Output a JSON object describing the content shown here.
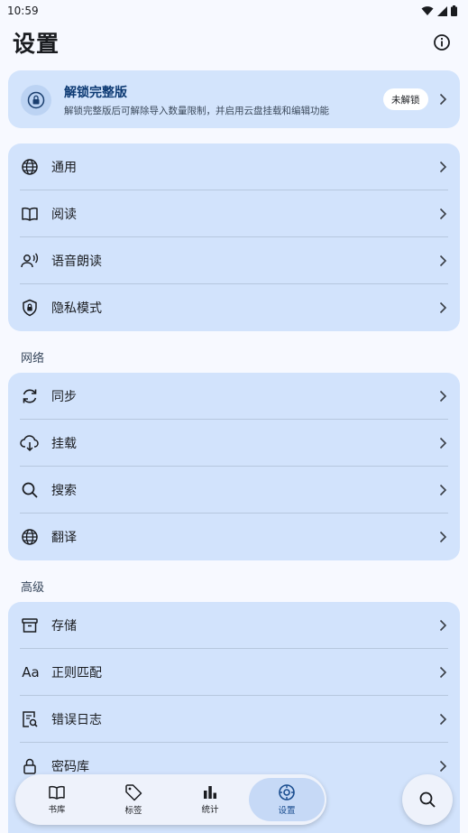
{
  "status_bar": {
    "time": "10:59"
  },
  "app_bar": {
    "title": "设置"
  },
  "unlock": {
    "title": "解锁完整版",
    "description": "解锁完整版后可解除导入数量限制，并启用云盘挂载和编辑功能",
    "badge": "未解锁"
  },
  "general_group": {
    "items": [
      {
        "label": "通用",
        "icon": "globe-icon"
      },
      {
        "label": "阅读",
        "icon": "book-open-icon"
      },
      {
        "label": "语音朗读",
        "icon": "voice-icon"
      },
      {
        "label": "隐私模式",
        "icon": "shield-lock-icon"
      }
    ]
  },
  "network_group": {
    "title": "网络",
    "items": [
      {
        "label": "同步",
        "icon": "sync-icon"
      },
      {
        "label": "挂载",
        "icon": "cloud-download-icon"
      },
      {
        "label": "搜索",
        "icon": "search-icon"
      },
      {
        "label": "翻译",
        "icon": "globe-icon"
      }
    ]
  },
  "advanced_group": {
    "title": "高级",
    "items": [
      {
        "label": "存储",
        "icon": "archive-icon"
      },
      {
        "label": "正则匹配",
        "icon": "text-aa-icon",
        "icon_text": "Aa"
      },
      {
        "label": "错误日志",
        "icon": "log-search-icon"
      },
      {
        "label": "密码库",
        "icon": "lock-icon"
      }
    ]
  },
  "bottom_nav": {
    "items": [
      {
        "label": "书库",
        "icon": "book-icon"
      },
      {
        "label": "标签",
        "icon": "tag-icon"
      },
      {
        "label": "统计",
        "icon": "bar-chart-icon"
      },
      {
        "label": "设置",
        "icon": "settings-icon",
        "active": true
      }
    ]
  },
  "colors": {
    "card": "#d2e3fc",
    "background": "#f7f9ff",
    "accent": "#1a4d8f"
  }
}
